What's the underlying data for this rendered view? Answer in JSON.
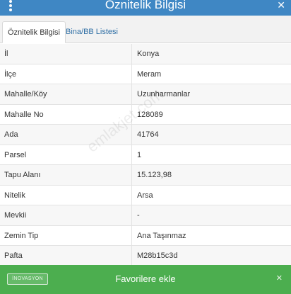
{
  "header": {
    "title": "Öznitelik Bilgisi",
    "close_icon": "close-icon",
    "menu_icon": "more-vertical-icon"
  },
  "tabs": [
    {
      "label": "Öznitelik Bilgisi",
      "active": true
    },
    {
      "label": "Bina/BB Listesi",
      "active": false
    }
  ],
  "attributes": [
    {
      "key": "İl",
      "value": "Konya"
    },
    {
      "key": "İlçe",
      "value": "Meram"
    },
    {
      "key": "Mahalle/Köy",
      "value": "Uzunharmanlar"
    },
    {
      "key": "Mahalle No",
      "value": "128089"
    },
    {
      "key": "Ada",
      "value": "41764"
    },
    {
      "key": "Parsel",
      "value": "1"
    },
    {
      "key": "Tapu Alanı",
      "value": "15.123,98"
    },
    {
      "key": "Nitelik",
      "value": "Arsa"
    },
    {
      "key": "Mevkii",
      "value": "-"
    },
    {
      "key": "Zemin Tip",
      "value": "Ana Taşınmaz"
    },
    {
      "key": "Pafta",
      "value": "M28b15c3d"
    }
  ],
  "footer": {
    "favorite_label": "Favorilere ekle",
    "logo_text": "İNOVASYON",
    "close_icon": "close-icon"
  },
  "watermark": "emlakjet.com",
  "colors": {
    "header": "#3f87c4",
    "footer": "#4cae4f",
    "tab_link": "#2f6fa5"
  }
}
